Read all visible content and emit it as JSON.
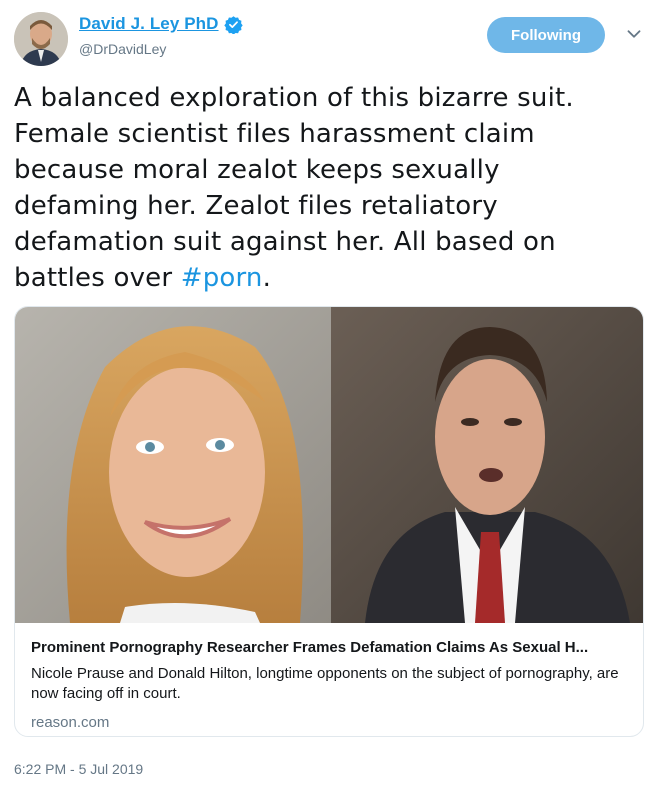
{
  "author": {
    "display_name": "David J. Ley PhD",
    "handle": "@DrDavidLey",
    "verified": true
  },
  "follow_button": {
    "label": "Following"
  },
  "more_menu": {
    "icon": "chevron-down-icon"
  },
  "tweet": {
    "lines": [
      "A balanced exploration of this bizarre suit.",
      "Female scientist files harassment claim",
      "because moral zealot keeps sexually",
      "defaming her. Zealot files retaliatory",
      "defamation suit against her. All based on"
    ],
    "last_line_prefix": "battles over ",
    "hashtag": "#porn",
    "last_line_suffix": "."
  },
  "card": {
    "title": "Prominent Pornography Researcher Frames Defamation Claims As Sexual H...",
    "description": "Nicole Prause and Donald Hilton, longtime opponents on the subject of pornography, are now facing off in court.",
    "domain": "reason.com"
  },
  "timestamp": "6:22 PM - 5 Jul 2019",
  "colors": {
    "link_blue": "#1b95e0",
    "follow_button_bg": "#6fb7e8",
    "muted_text": "#657786",
    "border": "#e1e8ed"
  }
}
